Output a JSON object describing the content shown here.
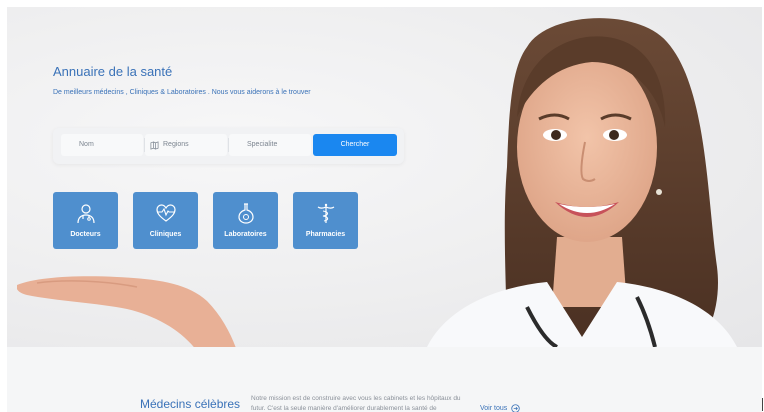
{
  "hero": {
    "title": "Annuaire de la santé",
    "subtitle": "De meilleurs médecins , Cliniques & Laboratoires . Nous vous aiderons à le trouver"
  },
  "search": {
    "nom": "Nom",
    "regions": "Regions",
    "specialite": "Specialite",
    "button": "Chercher"
  },
  "categories": [
    {
      "label": "Docteurs",
      "icon": "doctor-icon"
    },
    {
      "label": "Cliniques",
      "icon": "heartbeat-icon"
    },
    {
      "label": "Laboratoires",
      "icon": "flask-icon"
    },
    {
      "label": "Pharmacies",
      "icon": "caduceus-icon"
    }
  ],
  "section": {
    "title": "Médecins célèbres",
    "mission": "Notre mission est de construire avec vous les cabinets et les hôpitaux du futur. C'est la seule manière d'améliorer durablement la santé de",
    "link": "Voir tous"
  },
  "colors": {
    "accent": "#1a87f0",
    "tile": "#4f8fce",
    "heading": "#3a72b8"
  }
}
